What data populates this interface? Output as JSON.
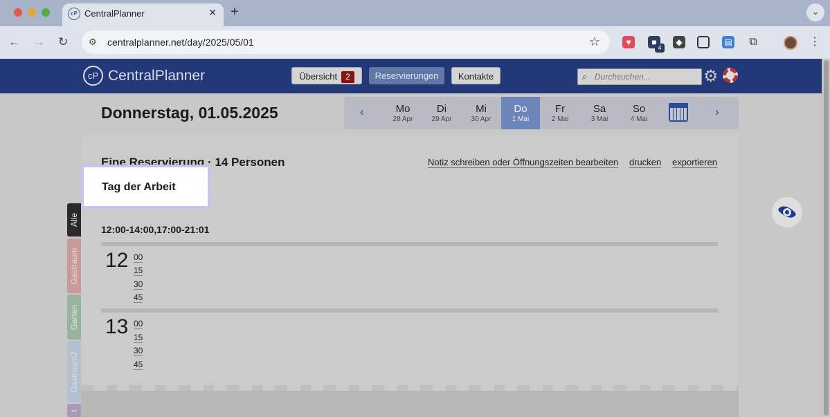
{
  "browser": {
    "tab_title": "CentralPlanner",
    "url": "centralplanner.net/day/2025/05/01",
    "extension_badge": "4"
  },
  "app": {
    "logo_mark": "cP",
    "logo_text": "CentralPlanner",
    "nav": {
      "overview": "Übersicht",
      "overview_count": "2",
      "reservations": "Reservierungen",
      "contacts": "Kontakte"
    },
    "search_placeholder": "Durchsuchen..."
  },
  "day": {
    "title": "Donnerstag, 01.05.2025",
    "week": [
      {
        "name": "Mo",
        "date": "28 Apr"
      },
      {
        "name": "Di",
        "date": "29 Apr"
      },
      {
        "name": "Mi",
        "date": "30 Apr"
      },
      {
        "name": "Do",
        "date": "1 Mai",
        "active": true
      },
      {
        "name": "Fr",
        "date": "2 Mai"
      },
      {
        "name": "Sa",
        "date": "3 Mai"
      },
      {
        "name": "So",
        "date": "4 Mai"
      }
    ]
  },
  "content": {
    "summary": "Eine Reservierung · 14 Personen",
    "actions": {
      "note": "Notiz schreiben oder Öffnungszeiten bearbeiten",
      "print": "drucken",
      "export": "exportieren"
    },
    "note": "Tag der Arbeit",
    "opening_hours": "12:00-14:00,17:00-21:01",
    "schedule": [
      {
        "hour": "12",
        "quarters": [
          "00",
          "15",
          "30",
          "45"
        ]
      },
      {
        "hour": "13",
        "quarters": [
          "00",
          "15",
          "30",
          "45"
        ]
      }
    ]
  },
  "side_tabs": [
    {
      "label": "Alle",
      "color": "#2a2a2a",
      "text_color": "#e8e8e8"
    },
    {
      "label": "Gastraum",
      "color": "#c99a9a",
      "text_color": "#e8d8d8"
    },
    {
      "label": "Garten",
      "color": "#9ab39e",
      "text_color": "#dde8de"
    },
    {
      "label": "Gastraum2",
      "color": "#b4bfd0",
      "text_color": "#d8dee8"
    },
    {
      "label": "t",
      "color": "#a89ab8",
      "text_color": "#e0d8e8"
    }
  ],
  "colors": {
    "header": "#223879",
    "accent": "#2e4a9a",
    "active_day": "#6e85b9",
    "badge": "#8a1111"
  }
}
